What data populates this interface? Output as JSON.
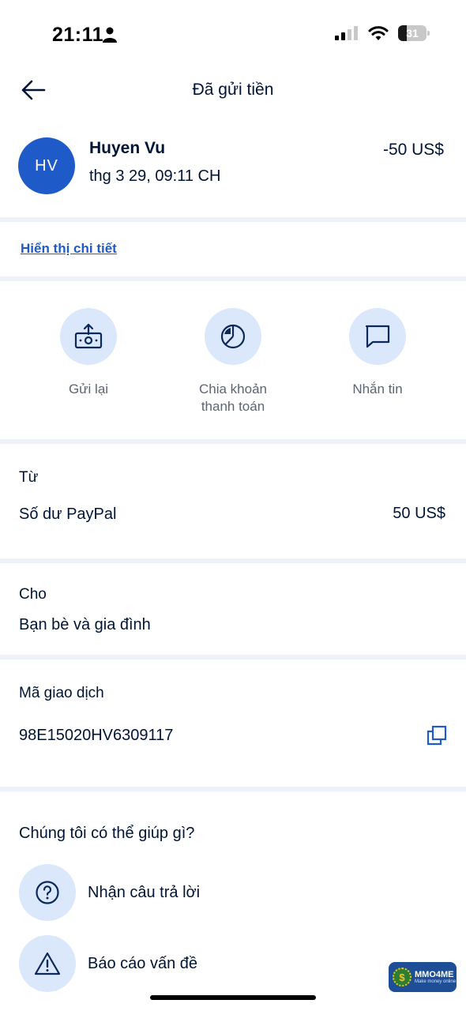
{
  "status_bar": {
    "time": "21:11",
    "battery": "31",
    "icons": [
      "person-icon",
      "signal-icon",
      "wifi-icon",
      "battery-icon"
    ]
  },
  "header": {
    "title": "Đã gửi tiền",
    "back_icon": "arrow-left-icon"
  },
  "transaction": {
    "avatar_initials": "HV",
    "name": "Huyen Vu",
    "date": "thg 3 29, 09:11 CH",
    "amount": "-50 US$"
  },
  "details_link": "Hiển thị chi tiết",
  "actions": [
    {
      "label_line1": "Gửi lại",
      "label_line2": "",
      "icon": "send-money-icon"
    },
    {
      "label_line1": "Chia khoản",
      "label_line2": "thanh toán",
      "icon": "split-payment-icon"
    },
    {
      "label_line1": "Nhắn tin",
      "label_line2": "",
      "icon": "message-icon"
    }
  ],
  "from_section": {
    "label": "Từ",
    "source": "Số dư PayPal",
    "amount": "50 US$"
  },
  "to_section": {
    "label": "Cho",
    "value": "Bạn bè và gia đình"
  },
  "transaction_id_section": {
    "label": "Mã giao dịch",
    "value": "98E15020HV6309117",
    "copy_icon": "copy-icon"
  },
  "help": {
    "title": "Chúng tôi có thể giúp gì?",
    "items": [
      {
        "label": "Nhận câu trả lời",
        "icon": "question-icon"
      },
      {
        "label": "Báo cáo vấn đề",
        "icon": "warning-icon"
      }
    ]
  },
  "watermark": {
    "title": "MMO4ME",
    "subtitle": "Make money online",
    "coin_symbol": "$"
  },
  "colors": {
    "primary_blue": "#1f5bc8",
    "text_dark": "#001435",
    "action_bg": "#dbe8fc",
    "divider": "#eef2f8",
    "muted_text": "#5b6574"
  }
}
